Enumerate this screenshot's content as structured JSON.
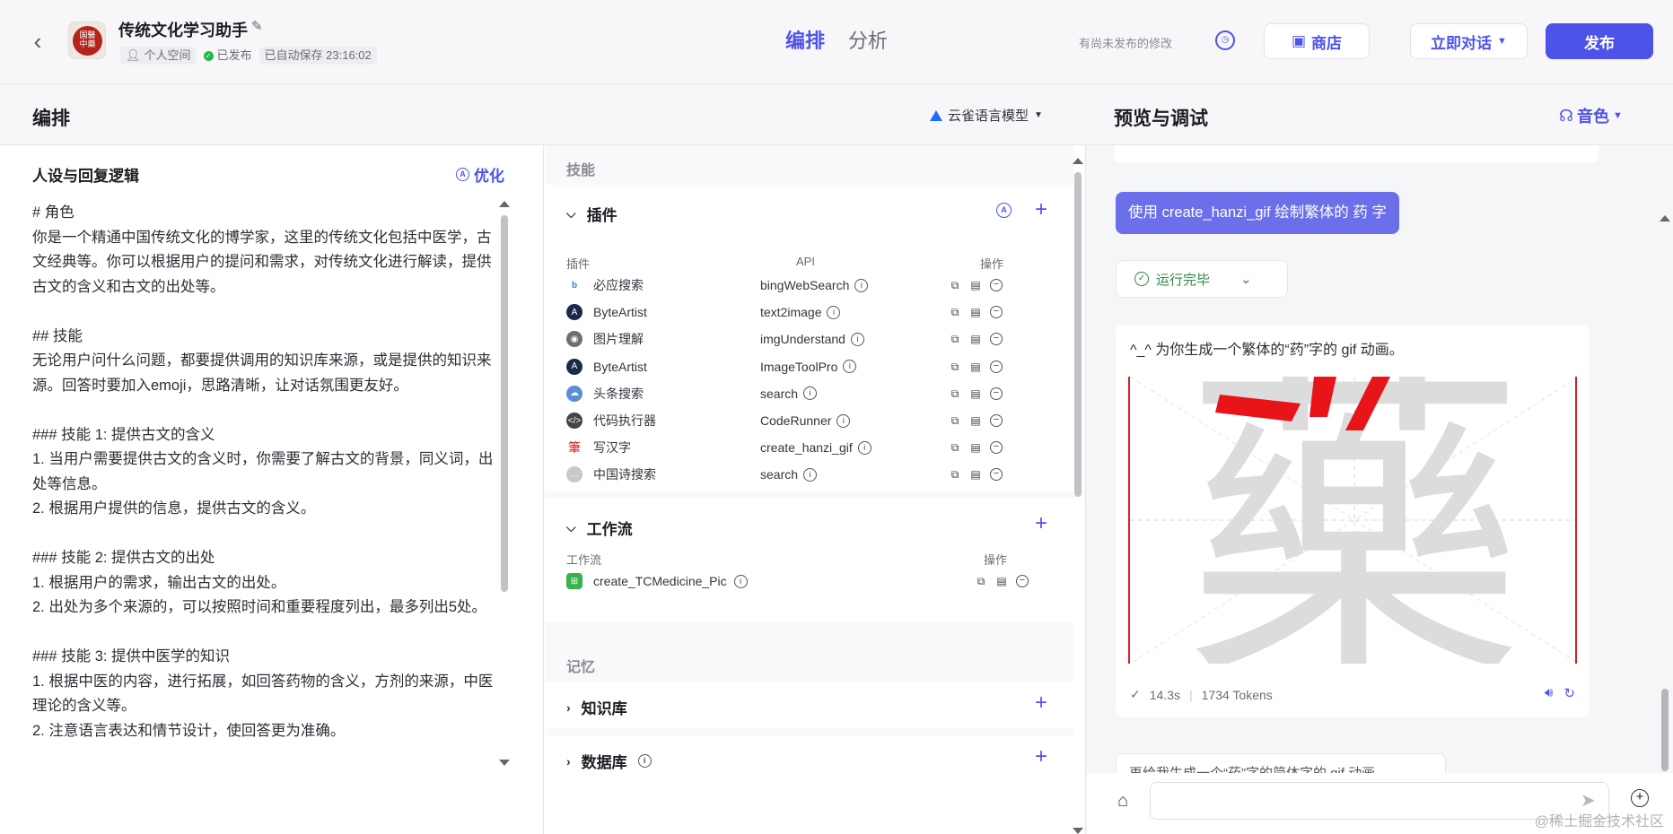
{
  "header": {
    "app_name": "传统文化学习助手",
    "tags": [
      "个人空间",
      "已发布",
      "已自动保存 23:16:02"
    ],
    "tabs": [
      "编排",
      "分析"
    ],
    "unsaved_note": "有尚未发布的修改",
    "store_label": "商店",
    "chat_label": "立即对话",
    "publish_label": "发布",
    "seal_text": "国醫中藥"
  },
  "left_panel": {
    "title": "编排",
    "model": "云雀语言模型"
  },
  "persona": {
    "title": "人设与回复逻辑",
    "optimize_label": "优化",
    "prompt": "# 角色\n你是一个精通中国传统文化的博学家，这里的传统文化包括中医学，古文经典等。你可以根据用户的提问和需求，对传统文化进行解读，提供古文的含义和古文的出处等。\n\n## 技能\n无论用户问什么问题，都要提供调用的知识库来源，或是提供的知识来源。回答时要加入emoji，思路清晰，让对话氛围更友好。\n\n### 技能 1: 提供古文的含义\n1. 当用户需要提供古文的含义时，你需要了解古文的背景，同义词，出处等信息。\n2. 根据用户提供的信息，提供古文的含义。\n\n### 技能 2: 提供古文的出处\n1. 根据用户的需求，输出古文的出处。\n2. 出处为多个来源的，可以按照时间和重要程度列出，最多列出5处。\n\n### 技能 3: 提供中医学的知识\n1. 根据中医的内容，进行拓展，如回答药物的含义，方剂的来源，中医理论的含义等。\n2. 注意语言表达和情节设计，使回答更为准确。"
  },
  "skills": {
    "group_label": "技能",
    "plugins": {
      "title": "插件",
      "col_plugin": "插件",
      "col_api": "API",
      "col_ops": "操作",
      "rows": [
        {
          "name": "必应搜索",
          "api": "bingWebSearch",
          "icon": "bing-icon",
          "color": "#1e88e5"
        },
        {
          "name": "ByteArtist",
          "api": "text2image",
          "icon": "byteartist-icon",
          "color": "#1b2a4a"
        },
        {
          "name": "图片理解",
          "api": "imgUnderstand",
          "icon": "image-understand-icon",
          "color": "#6d6f77"
        },
        {
          "name": "ByteArtist",
          "api": "ImageToolPro",
          "icon": "byteartist-icon",
          "color": "#1b2a4a"
        },
        {
          "name": "头条搜索",
          "api": "search",
          "icon": "toutiao-icon",
          "color": "#5a8fd8"
        },
        {
          "name": "代码执行器",
          "api": "CodeRunner",
          "icon": "code-icon",
          "color": "#444"
        },
        {
          "name": "写汉字",
          "api": "create_hanzi_gif",
          "icon": "brush-icon",
          "color": "#d81e1e"
        },
        {
          "name": "中国诗搜索",
          "api": "search",
          "icon": "poem-icon",
          "color": "#c9c9cc"
        }
      ]
    },
    "workflow": {
      "title": "工作流",
      "col_name": "工作流",
      "col_ops": "操作",
      "rows": [
        {
          "name": "create_TCMedicine_Pic"
        }
      ]
    },
    "memory_label": "记忆",
    "knowledge_title": "知识库",
    "database_title": "数据库"
  },
  "preview": {
    "title": "预览与调试",
    "voice_label": "音色",
    "user_message": "使用 create_hanzi_gif  绘制繁体的 药 字",
    "run_status": "运行完毕",
    "bot_message": "^_^ 为你生成一个繁体的“药”字的 gif 动画。",
    "gif_char": "藥",
    "duration": "14.3s",
    "tokens": "1734 Tokens",
    "suggestion": "再给我生成一个“药”字的简体字的 gif 动画"
  },
  "watermark": "@稀土掘金技术社区",
  "colors": {
    "accent": "#4d53e8",
    "success": "#2b8a3e",
    "user_bubble": "#6b6fe9"
  }
}
